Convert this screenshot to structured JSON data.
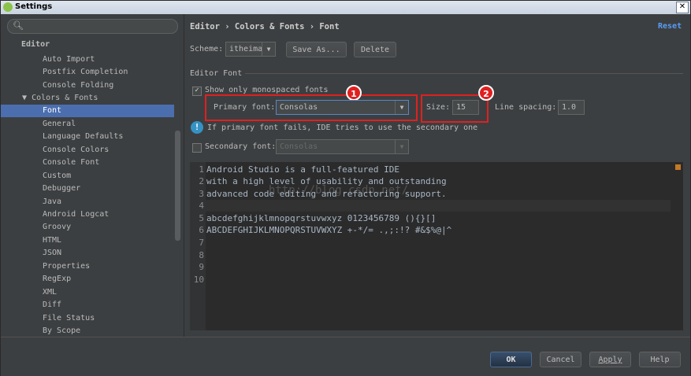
{
  "window": {
    "title": "Settings"
  },
  "sidebar": {
    "search_placeholder": "",
    "section": "Editor",
    "items": [
      "Auto Import",
      "Postfix Completion",
      "Console Folding",
      "Colors & Fonts",
      "Font",
      "General",
      "Language Defaults",
      "Console Colors",
      "Console Font",
      "Custom",
      "Debugger",
      "Java",
      "Android Logcat",
      "Groovy",
      "HTML",
      "JSON",
      "Properties",
      "RegExp",
      "XML",
      "Diff",
      "File Status",
      "By Scope"
    ],
    "selected": "Font",
    "expanded_marker": "▼"
  },
  "header": {
    "breadcrumb": "Editor › Colors & Fonts › Font",
    "reset": "Reset"
  },
  "scheme": {
    "label": "Scheme:",
    "value": "itheima",
    "save_as": "Save As...",
    "delete": "Delete"
  },
  "editor_font": {
    "section_title": "Editor Font",
    "show_monospaced_label": "Show only monospaced fonts",
    "show_monospaced_checked": true,
    "primary_font_label": "Primary font:",
    "primary_font_value": "Consolas",
    "size_label": "Size:",
    "size_value": "15",
    "line_spacing_label": "Line spacing:",
    "line_spacing_value": "1.0",
    "info_text": "If primary font fails, IDE tries to use the secondary one",
    "secondary_font_label": "Secondary font:",
    "secondary_font_value": "Consolas",
    "secondary_checked": false
  },
  "annotations": {
    "badge1": "1",
    "badge2": "2",
    "color": "#e02020"
  },
  "preview": {
    "lines": [
      {
        "n": "1",
        "text": "Android Studio is a full-featured IDE"
      },
      {
        "n": "2",
        "text": "with a high level of usability and outstanding"
      },
      {
        "n": "3",
        "text": "advanced code editing and refactoring support."
      },
      {
        "n": "4",
        "text": ""
      },
      {
        "n": "5",
        "text": "abcdefghijklmnopqrstuvwxyz 0123456789 (){}[]"
      },
      {
        "n": "6",
        "text": "ABCDEFGHIJKLMNOPQRSTUVWXYZ +-*/= .,;:!? #&$%@|^"
      },
      {
        "n": "7",
        "text": ""
      },
      {
        "n": "8",
        "text": ""
      },
      {
        "n": "9",
        "text": ""
      },
      {
        "n": "10",
        "text": ""
      }
    ],
    "watermark": "http://blog.csdn.net/"
  },
  "footer": {
    "ok": "OK",
    "cancel": "Cancel",
    "apply": "Apply",
    "help": "Help"
  }
}
